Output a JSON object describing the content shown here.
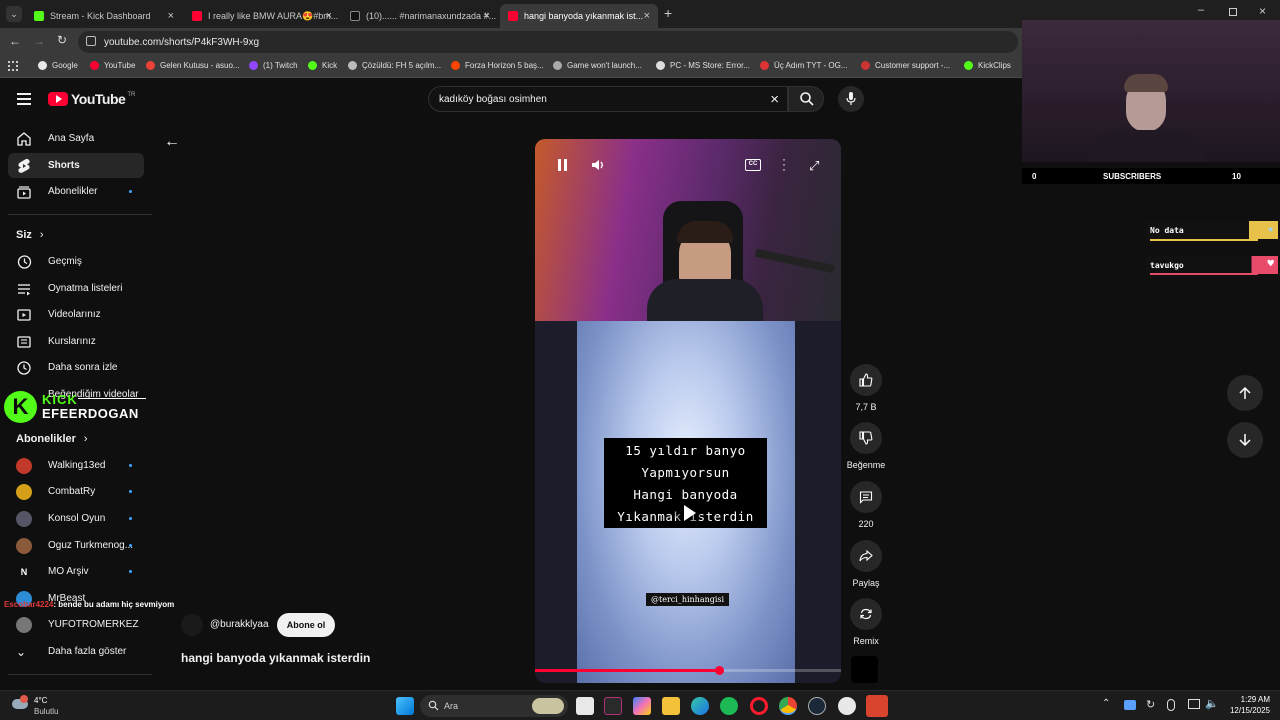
{
  "tabs": [
    {
      "title": "Stream - Kick Dashboard",
      "color": "#53fc18"
    },
    {
      "title": "I really like BMW AURA😍#bm...",
      "color": "#ff0033"
    },
    {
      "title": "(10)...... #narimanaxundzada #...",
      "color": "#111111"
    },
    {
      "title": "hangi banyoda yıkanmak ist...",
      "color": "#ff0033"
    }
  ],
  "address": "youtube.com/shorts/P4kF3WH-9xg",
  "bookmarks": [
    "Google",
    "YouTube",
    "Gelen Kutusu - asuo...",
    "(1) Twitch",
    "Kick",
    "Çözüldü: FH 5 açılm...",
    "Forza Horizon 5 baş...",
    "Game won't launch...",
    "PC - MS Store: Error...",
    "Üç Adım TYT - OG...",
    "Customer support -...",
    "KickClips"
  ],
  "youtube": {
    "logo": "YouTube",
    "region": "TR",
    "search_value": "kadıköy boğası osimhen"
  },
  "sidebar": {
    "main": [
      "Ana Sayfa",
      "Shorts",
      "Abonelikler"
    ],
    "you_title": "Siz",
    "you": [
      "Geçmiş",
      "Oynatma listeleri",
      "Videolarınız",
      "Kurslarınız",
      "Daha sonra izle",
      "Beğendiğim videolar"
    ],
    "subs_title": "Abonelikler",
    "subs": [
      "Walking13ed",
      "CombatRy",
      "Konsol Oyun",
      "Oguz Turkmenog...",
      "MO Arşiv",
      "MrBeast",
      "YUFOTROMERKEZ"
    ],
    "more": "Daha fazla göster"
  },
  "kick_overlay": {
    "brand": "KICK",
    "channel": "EFEERDOGAN"
  },
  "chat_overlay": {
    "user": "Escobar4224",
    "message": ": bende bu adamı hiç sevmiyom"
  },
  "short": {
    "caption_lines": [
      "15 yıldır banyo",
      "Yapmıyorsun",
      "Hangi banyoda",
      "Yıkanmak isterdin"
    ],
    "watermark": "@terci_hinhangisi",
    "channel": "@burakklyaa",
    "subscribe": "Abone ol",
    "title": "hangi banyoda yıkanmak isterdin",
    "progress": 0.6
  },
  "actions": {
    "likes": "7,7 B",
    "dislike": "Beğenme",
    "comments": "220",
    "share": "Paylaş",
    "remix": "Remix"
  },
  "stream_overlay": {
    "subs_left": "0",
    "subs_label": "SUBSCRIBERS",
    "subs_right": "10",
    "alert1": "No data",
    "alert2": "tavukgo"
  },
  "taskbar": {
    "temp": "4°C",
    "weather": "Bulutlu",
    "search": "Ara",
    "time": "1:29 AM",
    "date": "12/15/2025"
  }
}
